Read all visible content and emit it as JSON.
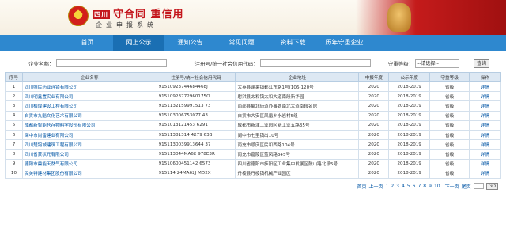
{
  "header": {
    "badge": "四川",
    "slogan": "守合同 重信用",
    "subtitle": "企业申报系统"
  },
  "nav": {
    "items": [
      "首页",
      "网上公示",
      "通知公告",
      "常见问题",
      "资料下载",
      "历年守重企业"
    ]
  },
  "search": {
    "company_label": "企业名称：",
    "code_label": "注册号/统一社会信用代码：",
    "level_label": "守重等级：",
    "level_value": "--请选择--",
    "query_label": "查询"
  },
  "table": {
    "headers": [
      "序号",
      "企业名称",
      "注册号/统一社会信用代码",
      "企业地址",
      "申报年度",
      "公示年度",
      "守重等级",
      "操作"
    ],
    "rows": [
      [
        "1",
        "四川照民药业连锁有限公司",
        "91510923744684468J",
        "大英县蓬莱镇郪江东路1号(106-120号",
        "2020",
        "2018-2019",
        "省级",
        "详情"
      ],
      [
        "2",
        "四川明鑫置实业有限公司",
        "91510923772960175O",
        "射洪县太和镇太和大道南段新华园",
        "2020",
        "2018-2019",
        "省级",
        "详情"
      ],
      [
        "3",
        "四川楷煌建设工程有限公司",
        "9151132159991513 73",
        "南部县蜀北街道办事处南北大道南段名居",
        "2020",
        "2018-2019",
        "省级",
        "详情"
      ],
      [
        "4",
        "自贡市九魁文化艺术有限公司",
        "915103006753077 43",
        "自贡市大安区凤凰乡水岩村5组",
        "2020",
        "2018-2019",
        "省级",
        "详情"
      ],
      [
        "5",
        "成都新智能仓存物料学股份有限公司",
        "9151013121453 6291",
        "成都市新津工业园区新工业五路35号",
        "2020",
        "2018-2019",
        "省级",
        "详情"
      ],
      [
        "6",
        "阆中市尚雷建业有限公司",
        "91511381314 4279 63B",
        "阆中市七里镇出10号",
        "2020",
        "2018-2019",
        "省级",
        "详情"
      ],
      [
        "7",
        "四川楚钧城建筑工程有限公司",
        "9151130039913644 37",
        "南充市顺庆区民和西路104号",
        "2020",
        "2018-2019",
        "省级",
        "详情"
      ],
      [
        "8",
        "四川省蒙状元有限公司",
        "915113044MA62 978E3R",
        "南充市嘉陵区蓝凤路345号",
        "2020",
        "2018-2019",
        "省级",
        "详情"
      ],
      [
        "9",
        "德阳市鼎能天然气有限公司",
        "91510600451142 6573",
        "四川省德阳市旌阳区工业集中发展区鼓山路北段5号",
        "2020",
        "2018-2019",
        "省级",
        "详情"
      ],
      [
        "10",
        "民美特建材集团股份有限公司",
        "915114 24MA62J MD2X",
        "丹棱县丹棱镇机械产业园区",
        "2020",
        "2018-2019",
        "省级",
        "详情"
      ]
    ]
  },
  "pager": {
    "first": "首页",
    "prev": "上一页",
    "pages": [
      "1",
      "2",
      "3",
      "4",
      "5",
      "6",
      "7",
      "8",
      "9",
      "10"
    ],
    "next": "下一页",
    "last": "尾页",
    "go": "GO"
  },
  "colors": {
    "nav_bg": "#2e88cf",
    "header_red": "#c4161c",
    "link_blue": "#0055a5"
  }
}
